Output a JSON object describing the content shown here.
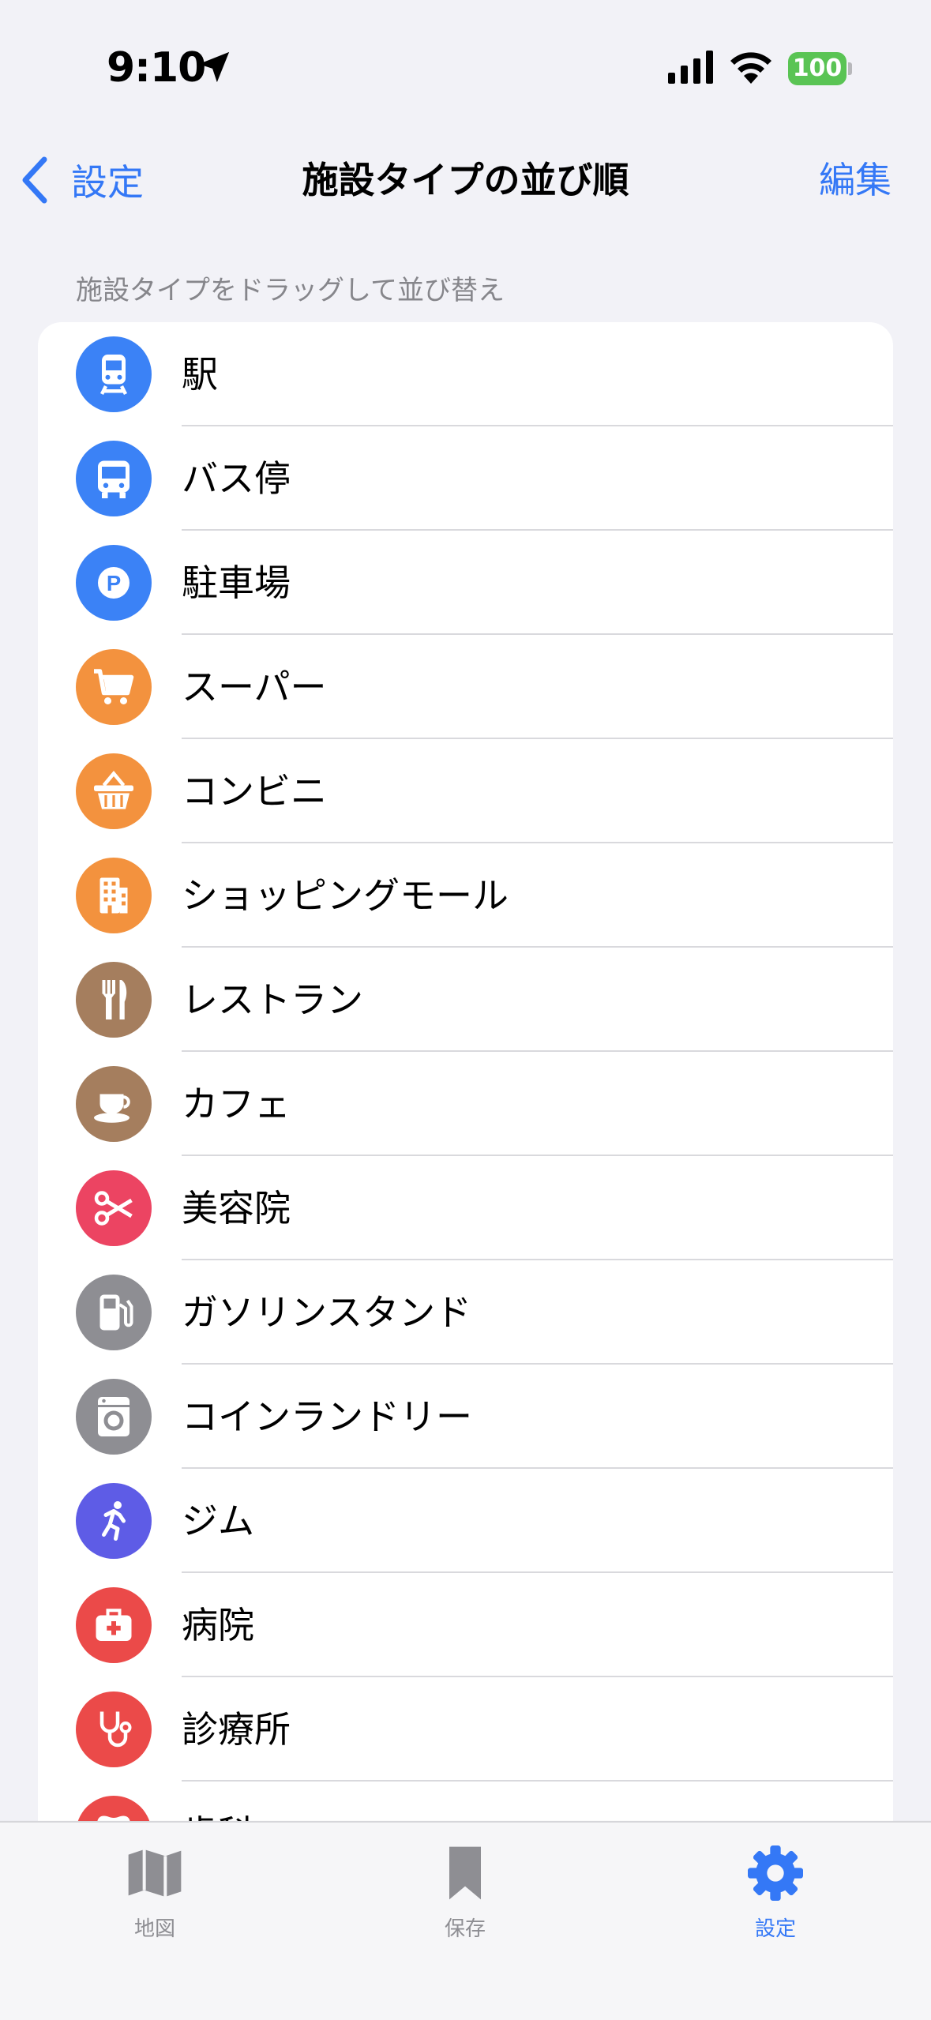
{
  "status": {
    "time": "9:10",
    "battery": "100"
  },
  "nav": {
    "back_label": "設定",
    "title": "施設タイプの並び順",
    "edit_label": "編集"
  },
  "hint": "施設タイプをドラッグして並び替え",
  "items": [
    {
      "label": "駅",
      "icon": "train-icon",
      "color": "#3b82f6"
    },
    {
      "label": "バス停",
      "icon": "bus-icon",
      "color": "#3b82f6"
    },
    {
      "label": "駐車場",
      "icon": "parking-icon",
      "color": "#3b82f6"
    },
    {
      "label": "スーパー",
      "icon": "cart-icon",
      "color": "#f3923e"
    },
    {
      "label": "コンビニ",
      "icon": "basket-icon",
      "color": "#f3923e"
    },
    {
      "label": "ショッピングモール",
      "icon": "building-icon",
      "color": "#f3923e"
    },
    {
      "label": "レストラン",
      "icon": "fork-knife-icon",
      "color": "#a57e5e"
    },
    {
      "label": "カフェ",
      "icon": "cup-icon",
      "color": "#a57e5e"
    },
    {
      "label": "美容院",
      "icon": "scissors-icon",
      "color": "#ec4462"
    },
    {
      "label": "ガソリンスタンド",
      "icon": "fuel-pump-icon",
      "color": "#8e8e93"
    },
    {
      "label": "コインランドリー",
      "icon": "washer-icon",
      "color": "#8e8e93"
    },
    {
      "label": "ジム",
      "icon": "runner-icon",
      "color": "#5e5ce6"
    },
    {
      "label": "病院",
      "icon": "medical-bag-icon",
      "color": "#eb4a49"
    },
    {
      "label": "診療所",
      "icon": "stethoscope-icon",
      "color": "#eb4a49"
    },
    {
      "label": "歯科",
      "icon": "tooth-icon",
      "color": "#eb4a49"
    }
  ],
  "tabs": {
    "map": "地図",
    "saved": "保存",
    "settings": "設定"
  }
}
